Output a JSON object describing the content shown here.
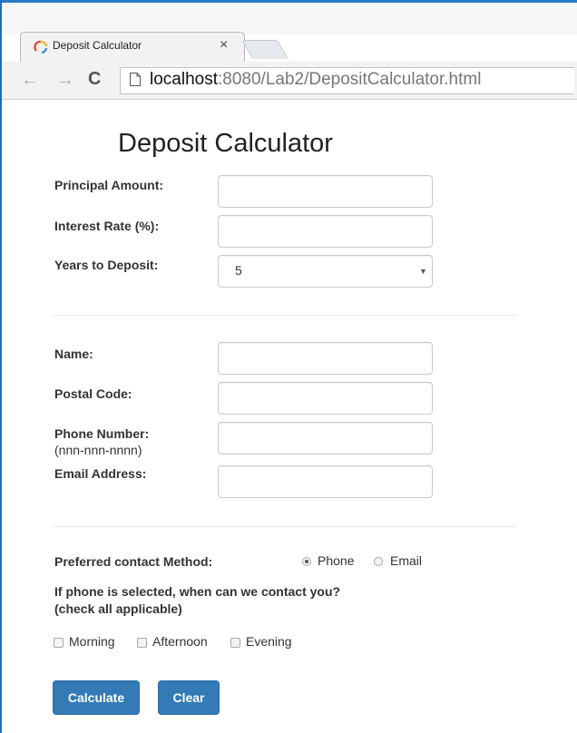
{
  "browser": {
    "tab_title": "Deposit Calculator",
    "tab_close": "×",
    "url_host": "localhost",
    "url_rest": ":8080/Lab2/DepositCalculator.html",
    "icons": {
      "back": "arrow-left-icon",
      "forward": "arrow-right-icon",
      "reload": "reload-icon",
      "page": "page-icon",
      "favicon": "favicon-icon"
    }
  },
  "form": {
    "heading": "Deposit Calculator",
    "principal_label": "Principal Amount:",
    "principal_value": "",
    "rate_label": "Interest Rate (%):",
    "rate_value": "",
    "years_label": "Years to Deposit:",
    "years_selected": "5",
    "name_label": "Name:",
    "name_value": "",
    "postal_label": "Postal Code:",
    "postal_value": "",
    "phone_label": "Phone Number:",
    "phone_hint": "(nnn-nnn-nnnn)",
    "phone_value": "",
    "email_label": "Email Address:",
    "email_value": "",
    "contact_method_label": "Preferred contact Method:",
    "contact_options": [
      {
        "label": "Phone",
        "checked": true
      },
      {
        "label": "Email",
        "checked": false
      }
    ],
    "contact_time_question_line1": "If phone is selected, when can we contact you?",
    "contact_time_question_line2": "(check all applicable)",
    "time_options": [
      {
        "label": "Morning",
        "checked": false
      },
      {
        "label": "Afternoon",
        "checked": false
      },
      {
        "label": "Evening",
        "checked": false
      }
    ],
    "calculate_label": "Calculate",
    "clear_label": "Clear"
  },
  "colors": {
    "primary_button": "#337ab7",
    "window_accent": "#1e6fb8"
  }
}
